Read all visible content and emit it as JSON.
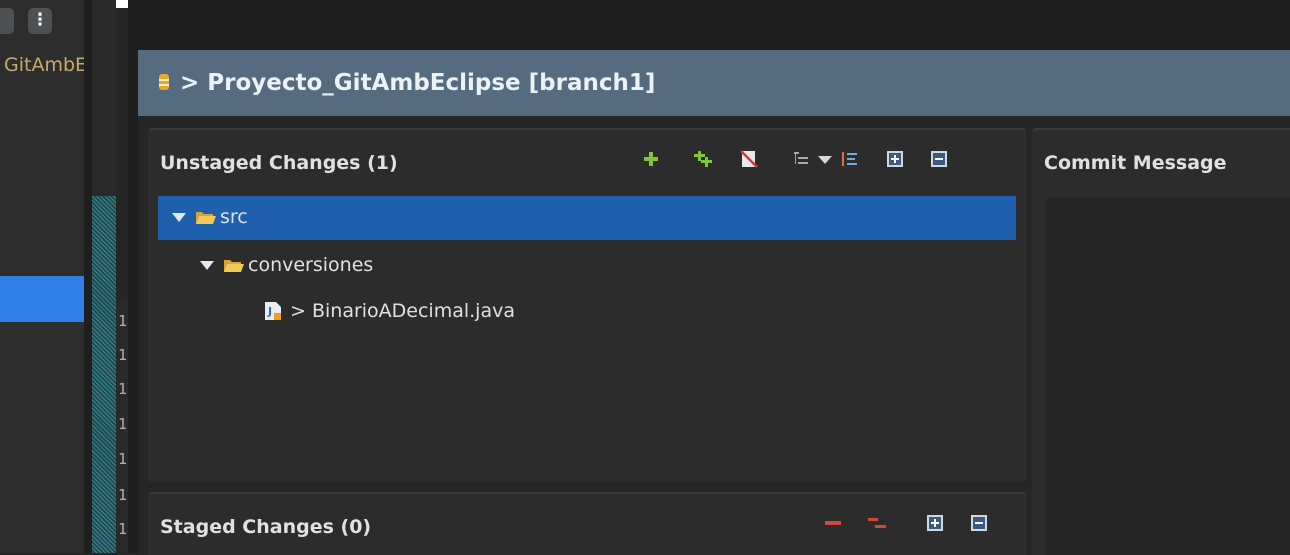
{
  "left_panel": {
    "menu_glyph": "⋮",
    "project_label": "GitAmbEclipse"
  },
  "line_numbers": [
    "1",
    "1",
    "1",
    "1",
    "1",
    "1",
    "1"
  ],
  "header": {
    "title": "> Proyecto_GitAmbEclipse [branch1]",
    "accent": "#556b7f"
  },
  "unstaged": {
    "title": "Unstaged Changes (1)",
    "toolbar": [
      "add-icon",
      "add-all-icon",
      "ignore-icon",
      "tree-presentation-icon",
      "dropdown-icon",
      "sort-icon",
      "expand-all-icon",
      "collapse-all-icon"
    ],
    "tree": [
      {
        "label": "src",
        "selected": true
      },
      {
        "label": "conversiones",
        "selected": false
      },
      {
        "label": "> BinarioADecimal.java",
        "selected": false
      }
    ]
  },
  "staged": {
    "title": "Staged Changes (0)",
    "toolbar": [
      "remove-icon",
      "remove-all-icon",
      "expand-all-icon",
      "collapse-all-icon"
    ]
  },
  "commit": {
    "title": "Commit Message"
  },
  "colors": {
    "selection": "#1e5fae",
    "left_highlight": "#2f7fe6",
    "add_green": "#7fc63a",
    "remove_red": "#d9453b"
  }
}
